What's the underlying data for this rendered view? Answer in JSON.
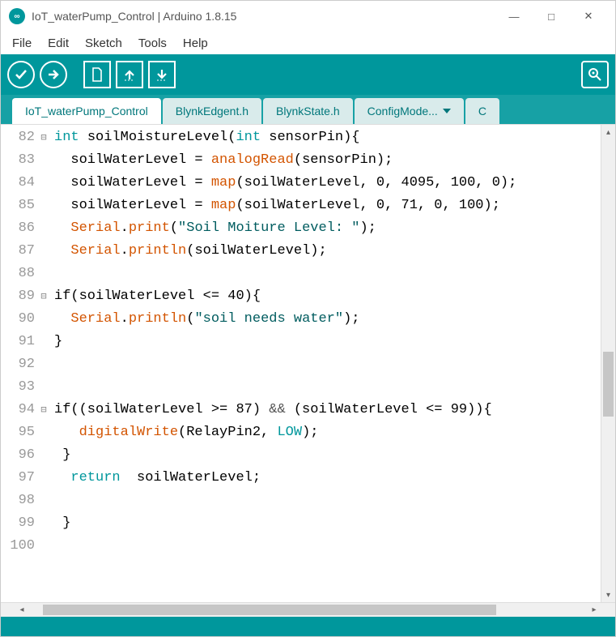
{
  "window": {
    "title": "IoT_waterPump_Control | Arduino 1.8.15"
  },
  "menu": {
    "file": "File",
    "edit": "Edit",
    "sketch": "Sketch",
    "tools": "Tools",
    "help": "Help"
  },
  "tabs": {
    "t0": "IoT_waterPump_Control",
    "t1": "BlynkEdgent.h",
    "t2": "BlynkState.h",
    "t3": "ConfigMode...",
    "t4": "C"
  },
  "code": {
    "lines": [
      {
        "num": "82",
        "fold": "⊟",
        "tokens": [
          {
            "t": "int ",
            "c": "tok-type"
          },
          {
            "t": "soilMoistureLevel"
          },
          {
            "t": "("
          },
          {
            "t": "int ",
            "c": "tok-type"
          },
          {
            "t": "sensorPin"
          },
          {
            "t": ")"
          },
          {
            "t": "{"
          }
        ]
      },
      {
        "num": "83",
        "fold": "",
        "tokens": [
          {
            "t": "  "
          },
          {
            "t": "soilWaterLevel = "
          },
          {
            "t": "analogRead",
            "c": "tok-fn"
          },
          {
            "t": "(sensorPin);"
          }
        ]
      },
      {
        "num": "84",
        "fold": "",
        "tokens": [
          {
            "t": "  "
          },
          {
            "t": "soilWaterLevel = "
          },
          {
            "t": "map",
            "c": "tok-fn"
          },
          {
            "t": "(soilWaterLevel, 0, 4095, 100, 0);"
          }
        ]
      },
      {
        "num": "85",
        "fold": "",
        "tokens": [
          {
            "t": "  "
          },
          {
            "t": "soilWaterLevel = "
          },
          {
            "t": "map",
            "c": "tok-fn"
          },
          {
            "t": "(soilWaterLevel, 0, 71, 0, 100);"
          }
        ]
      },
      {
        "num": "86",
        "fold": "",
        "tokens": [
          {
            "t": "  "
          },
          {
            "t": "Serial",
            "c": "tok-obj"
          },
          {
            "t": "."
          },
          {
            "t": "print",
            "c": "tok-fn"
          },
          {
            "t": "("
          },
          {
            "t": "\"Soil Moiture Level: \"",
            "c": "tok-str"
          },
          {
            "t": ");"
          }
        ]
      },
      {
        "num": "87",
        "fold": "",
        "tokens": [
          {
            "t": "  "
          },
          {
            "t": "Serial",
            "c": "tok-obj"
          },
          {
            "t": "."
          },
          {
            "t": "println",
            "c": "tok-fn"
          },
          {
            "t": "(soilWaterLevel);"
          }
        ]
      },
      {
        "num": "88",
        "fold": "",
        "tokens": []
      },
      {
        "num": "89",
        "fold": "⊟",
        "tokens": [
          {
            "t": "if"
          },
          {
            "t": "(soilWaterLevel <= 40){"
          }
        ]
      },
      {
        "num": "90",
        "fold": "",
        "tokens": [
          {
            "t": "  "
          },
          {
            "t": "Serial",
            "c": "tok-obj"
          },
          {
            "t": "."
          },
          {
            "t": "println",
            "c": "tok-fn"
          },
          {
            "t": "("
          },
          {
            "t": "\"soil needs water\"",
            "c": "tok-str"
          },
          {
            "t": ");"
          }
        ]
      },
      {
        "num": "91",
        "fold": "",
        "tokens": [
          {
            "t": "}"
          }
        ]
      },
      {
        "num": "92",
        "fold": "",
        "tokens": []
      },
      {
        "num": "93",
        "fold": "",
        "tokens": []
      },
      {
        "num": "94",
        "fold": "⊟",
        "tokens": [
          {
            "t": "if"
          },
          {
            "t": "((soilWaterLevel >= 87) "
          },
          {
            "t": "&&",
            "c": "tok-op"
          },
          {
            "t": " (soilWaterLevel <= 99)){"
          }
        ]
      },
      {
        "num": "95",
        "fold": "",
        "tokens": [
          {
            "t": "   "
          },
          {
            "t": "digitalWrite",
            "c": "tok-fn"
          },
          {
            "t": "(RelayPin2, "
          },
          {
            "t": "LOW",
            "c": "tok-const"
          },
          {
            "t": ");"
          }
        ]
      },
      {
        "num": "96",
        "fold": "",
        "tokens": [
          {
            "t": " }"
          }
        ]
      },
      {
        "num": "97",
        "fold": "",
        "tokens": [
          {
            "t": "  "
          },
          {
            "t": "return",
            "c": "tok-kw"
          },
          {
            "t": "  soilWaterLevel;"
          }
        ]
      },
      {
        "num": "98",
        "fold": "",
        "tokens": []
      },
      {
        "num": "99",
        "fold": "",
        "tokens": [
          {
            "t": " }"
          }
        ]
      },
      {
        "num": "100",
        "fold": "",
        "tokens": []
      }
    ]
  }
}
